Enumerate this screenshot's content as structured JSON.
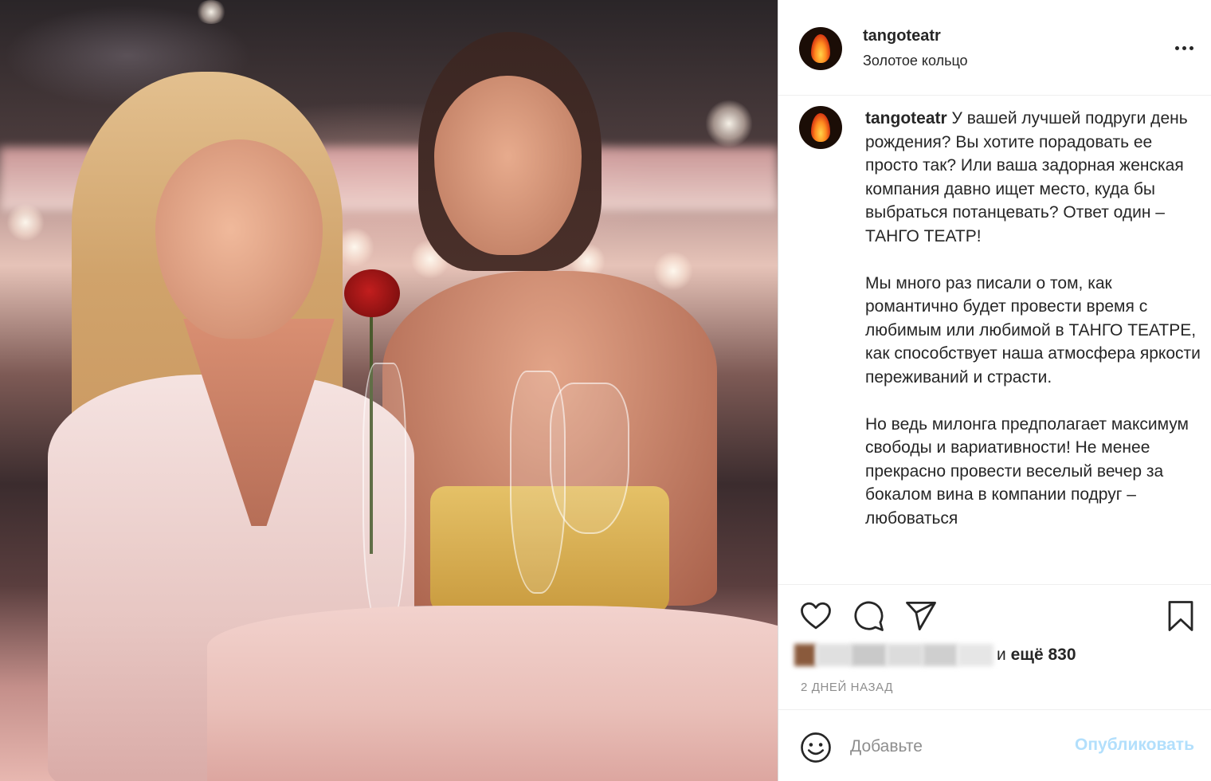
{
  "post": {
    "username": "tangoteatr",
    "location": "Золотое кольцо",
    "caption_username": "tangoteatr",
    "caption_text": " У вашей лучшей подруги день рождения? Вы хотите порадовать ее просто так? Или ваша задорная женская компания давно ищет место, куда бы выбраться потанцевать? Ответ один – ТАНГО ТЕАТР!\n\nМы много раз писали о том, как романтично будет провести время с любимым или любимой в ТАНГО ТЕАТРЕ, как способствует наша атмосфера яркости переживаний и страсти.\n\nНо ведь милонга предполагает максимум свободы и вариативности! Не менее прекрасно провести веселый вечер за бокалом вина в компании подруг – любоваться",
    "likes_prefix": "и ",
    "likes_count": "ещё 830",
    "time_ago": "2 дней назад"
  },
  "actions": {
    "like_icon": "heart-icon",
    "comment_icon": "speech-bubble-icon",
    "share_icon": "paper-plane-icon",
    "save_icon": "bookmark-icon"
  },
  "comment": {
    "placeholder": "Добавьте",
    "publish_label": "Опубликовать"
  },
  "colors": {
    "text": "#262626",
    "muted": "#8e8e8e",
    "publish_disabled": "#b2dffc",
    "divider": "#efefef"
  }
}
